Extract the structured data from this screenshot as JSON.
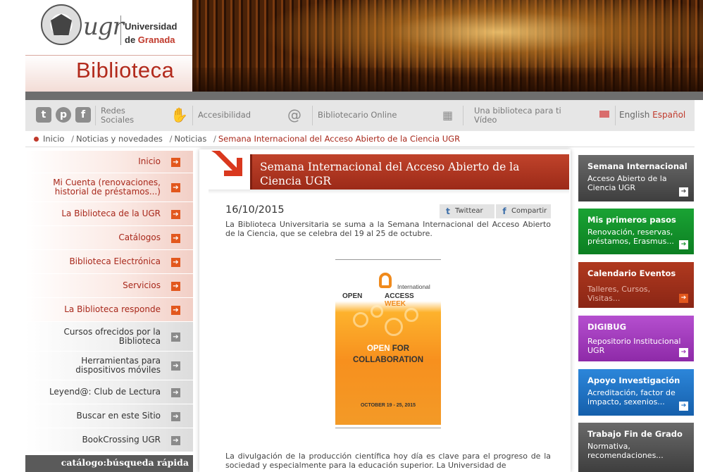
{
  "header": {
    "logo_text": "ugr",
    "university_line1": "Universidad",
    "university_line2_prefix": "de ",
    "university_line2_city": "Granada",
    "site_title": "Biblioteca"
  },
  "toolbar": {
    "social_icons": [
      "twitter-icon",
      "pinterest-icon",
      "facebook-icon"
    ],
    "social_t": "t",
    "social_p": "p",
    "social_f": "f",
    "redes_line1": "Redes",
    "redes_line2": "Sociales",
    "accesibilidad": "Accesibilidad",
    "bibliotecario": "Bibliotecario Online",
    "video_line1": "Una biblioteca para ti",
    "video_line2": "Vídeo",
    "lang_english": "English",
    "lang_espanol": "Español"
  },
  "breadcrumb": {
    "items": [
      "Inicio",
      "Noticias y novedades",
      "Noticias"
    ],
    "current": "Semana Internacional del Acceso Abierto de la Ciencia UGR"
  },
  "leftnav": {
    "items": [
      {
        "line1": "Inicio",
        "line2": ""
      },
      {
        "line1": "Mi Cuenta (renovaciones,",
        "line2": "historial de préstamos...)"
      },
      {
        "line1": "La Biblioteca de la UGR",
        "line2": ""
      },
      {
        "line1": "Catálogos",
        "line2": ""
      },
      {
        "line1": "Biblioteca Electrónica",
        "line2": ""
      },
      {
        "line1": "Servicios",
        "line2": ""
      },
      {
        "line1": "La Biblioteca responde",
        "line2": ""
      },
      {
        "line1": "Cursos ofrecidos por la",
        "line2": "Biblioteca"
      },
      {
        "line1": "Herramientas para",
        "line2": "dispositivos móviles"
      },
      {
        "line1": "Leyend@: Club de Lectura",
        "line2": ""
      },
      {
        "line1": "Buscar en este Sitio",
        "line2": ""
      },
      {
        "line1": "BookCrossing UGR",
        "line2": ""
      }
    ],
    "catalogo": "catálogo:búsqueda rápida"
  },
  "article": {
    "title": "Semana Internacional del Acceso Abierto de la Ciencia UGR",
    "date": "16/10/2015",
    "share_twitter": "Twittear",
    "share_facebook": "Compartir",
    "intro": "La Biblioteca Universitaria se suma a la Semana Internacional del Acceso Abierto de la Ciencia, que se celebra del 19 al 25 de octubre.",
    "poster": {
      "international": "International",
      "open": "OPEN",
      "access": "ACCESS",
      "week": "WEEK",
      "open_for_1": "OPEN",
      "open_for_2": "FOR",
      "collaboration": "COLLABORATION",
      "dates": "OCTOBER 19 - 25, 2015"
    },
    "para2": "La divulgación de la producción científica hoy día es clave para el progreso de la sociedad y especialmente para la educación superior. La Universidad de"
  },
  "rightboxes": [
    {
      "title": "Semana Internacional",
      "sub": "Acceso Abierto de la Ciencia UGR",
      "color": "#4d4d4d"
    },
    {
      "title": "Mis primeros pasos",
      "sub": "Renovación, reservas, préstamos, Erasmus...",
      "color": "#12912a"
    },
    {
      "title": "Calendario Eventos",
      "sub": "Talleres, Cursos, Visitas...",
      "color": "#a0301d"
    },
    {
      "title": "DIGIBUG",
      "sub": "Repositorio Institucional UGR",
      "color": "#9b35b5"
    },
    {
      "title": "Apoyo Investigación",
      "sub": "Acreditación, factor de impacto, sexenios...",
      "color": "#1f73c6"
    },
    {
      "title": "Trabajo Fin de Grado",
      "sub": "Normativa, recomendaciones...",
      "color": "#555555"
    }
  ],
  "arrow_glyph": "➔"
}
